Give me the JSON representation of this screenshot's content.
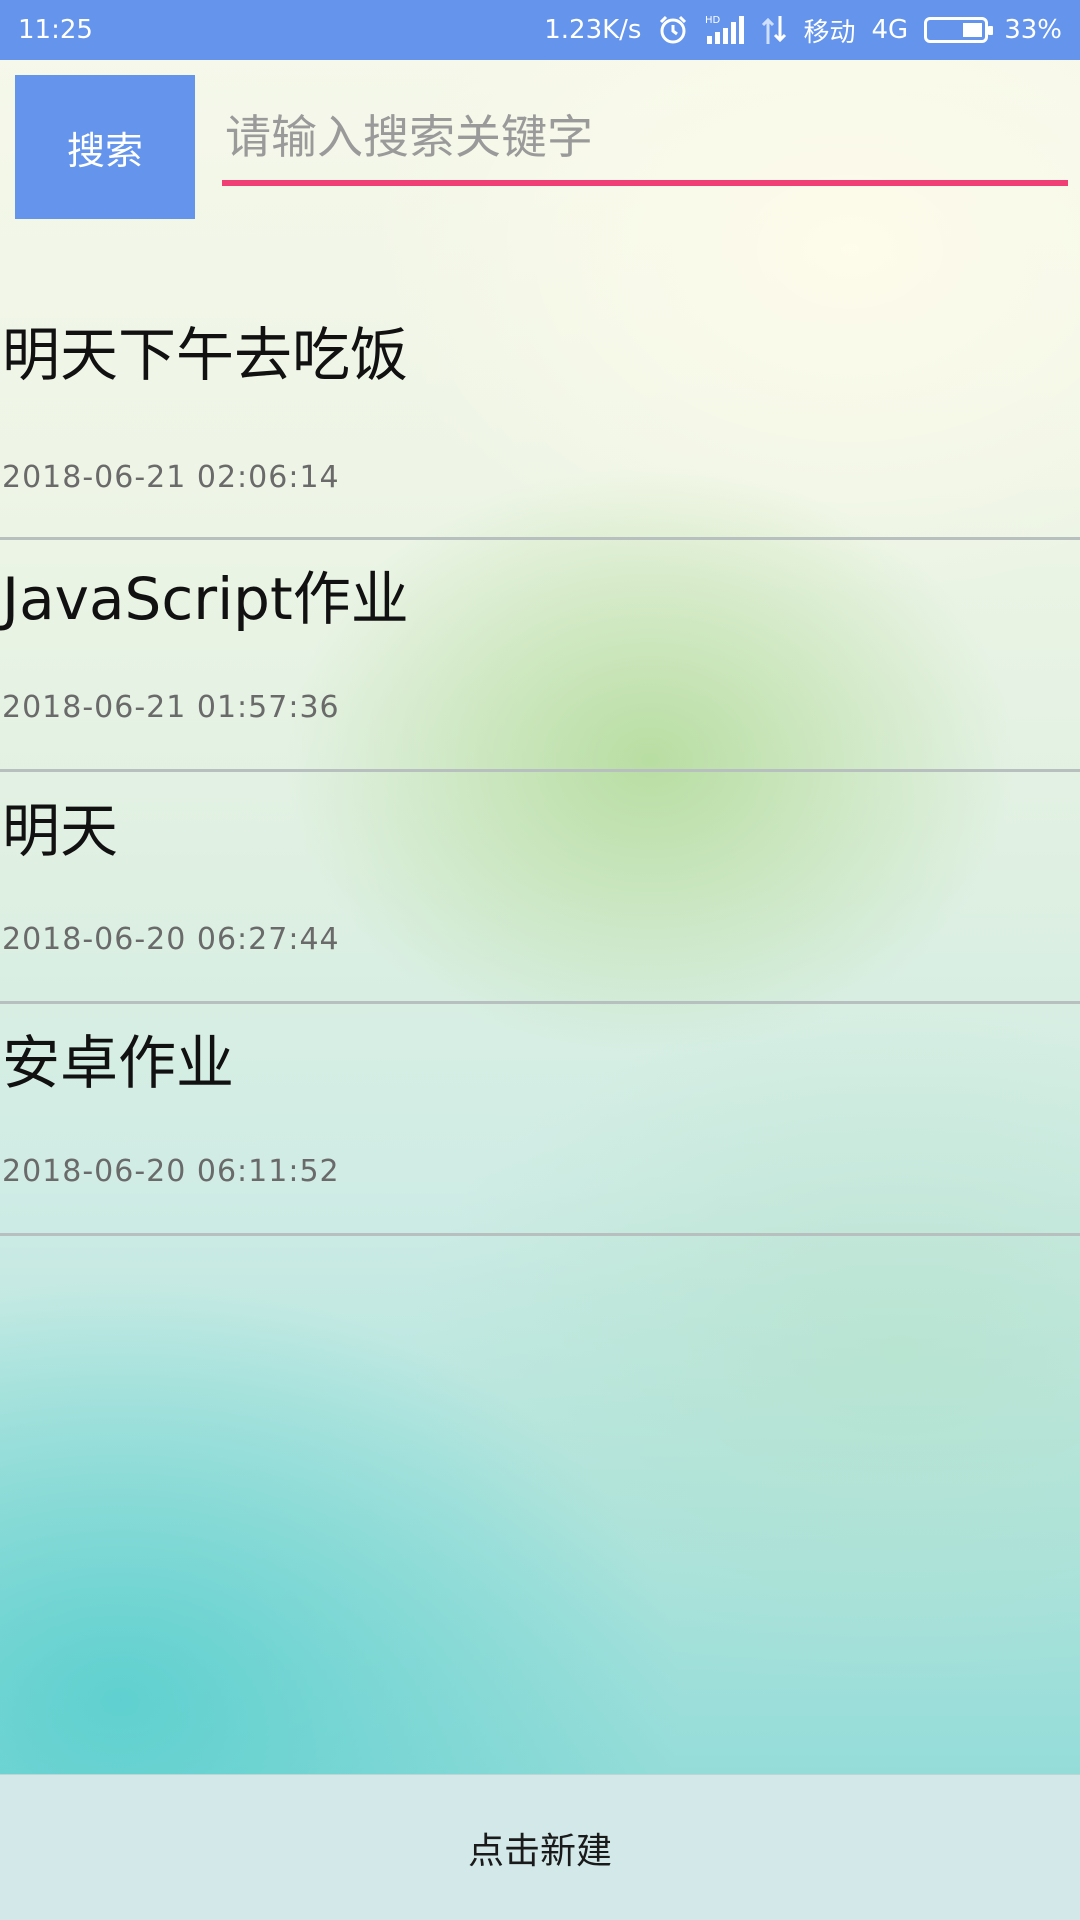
{
  "status_bar": {
    "time": "11:25",
    "net_speed": "1.23K/s",
    "hd_label": "HD",
    "carrier": "移动",
    "network": "4G",
    "battery_level": 0.33,
    "battery_text": "33%"
  },
  "search": {
    "button_label": "搜索",
    "placeholder": "请输入搜索关键字",
    "value": ""
  },
  "notes": [
    {
      "title": "明天下午去吃饭",
      "time": "2018-06-21 02:06:14"
    },
    {
      "title": "JavaScript作业",
      "time": "2018-06-21 01:57:36"
    },
    {
      "title": "明天",
      "time": "2018-06-20 06:27:44"
    },
    {
      "title": "安卓作业",
      "time": "2018-06-20 06:11:52"
    }
  ],
  "footer": {
    "new_button_label": "点击新建"
  },
  "colors": {
    "accent": "#6494ec",
    "underline": "#ef3f74"
  }
}
